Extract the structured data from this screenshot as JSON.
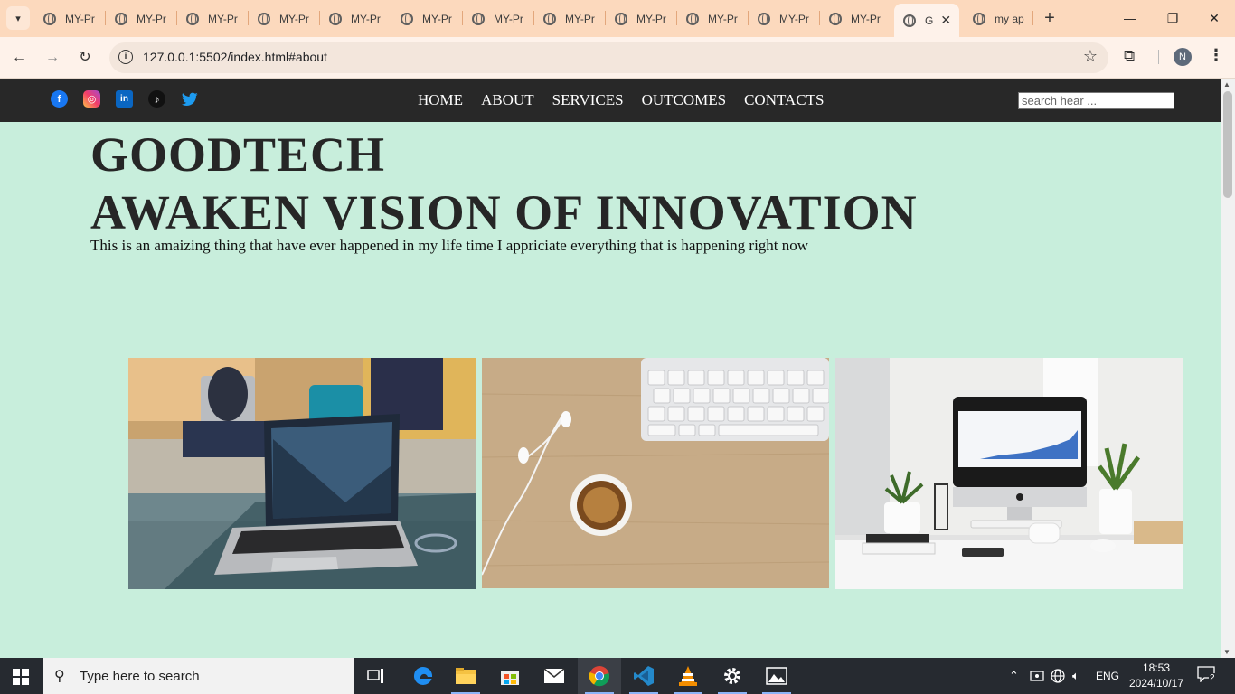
{
  "browser": {
    "tabs": [
      {
        "label": "MY-Pr",
        "active": false
      },
      {
        "label": "MY-Pr",
        "active": false
      },
      {
        "label": "MY-Pr",
        "active": false
      },
      {
        "label": "MY-Pr",
        "active": false
      },
      {
        "label": "MY-Pr",
        "active": false
      },
      {
        "label": "MY-Pr",
        "active": false
      },
      {
        "label": "MY-Pr",
        "active": false
      },
      {
        "label": "MY-Pr",
        "active": false
      },
      {
        "label": "MY-Pr",
        "active": false
      },
      {
        "label": "MY-Pr",
        "active": false
      },
      {
        "label": "MY-Pr",
        "active": false
      },
      {
        "label": "MY-Pr",
        "active": false
      },
      {
        "label": "G",
        "active": true
      },
      {
        "label": "my ap",
        "active": false
      }
    ],
    "url": "127.0.0.1:5502/index.html#about",
    "profile_initial": "N",
    "colors": {
      "frame": "#fcd9bd",
      "toolbar": "#fef2ea"
    }
  },
  "site": {
    "social": [
      "facebook-icon",
      "instagram-icon",
      "linkedin-icon",
      "tiktok-icon",
      "twitter-icon"
    ],
    "nav": {
      "home": "HOME",
      "about": "ABOUT",
      "services": "SERVICES",
      "outcomes": "OUTCOMES",
      "contacts": "CONTACTS"
    },
    "search_placeholder": "search hear ...",
    "hero": {
      "title_line1": "GOODTECH",
      "title_line2": "AWAKEN VISION OF INNOVATION",
      "text": "This is an amaizing thing that have ever happened in my life time I appriciate everything that is happening right now"
    },
    "colors": {
      "nav_bg": "#282828",
      "page_bg": "#c8eedc"
    }
  },
  "taskbar": {
    "search_text": "Type here to search",
    "language": "ENG",
    "time": "18:53",
    "date": "2024/10/17",
    "notifications": "2"
  }
}
